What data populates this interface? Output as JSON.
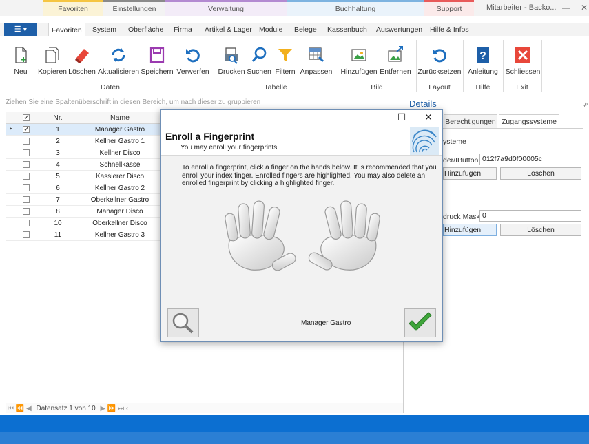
{
  "categories": [
    {
      "label": "Favoriten",
      "color": "#f5c542"
    },
    {
      "label": "Einstellungen",
      "color": "#8a8a8a"
    },
    {
      "label": "Verwaltung",
      "color": "#b38ad1"
    },
    {
      "label": "Buchhaltung",
      "color": "#7db3e0"
    },
    {
      "label": "Support",
      "color": "#e85a5a"
    }
  ],
  "window": {
    "title": "Mitarbeiter - Backo...",
    "minimize": "—",
    "restore": "▭",
    "close": "✕"
  },
  "app_menu": "☰ ▾",
  "tabs": [
    "Favoriten",
    "System",
    "Oberfläche",
    "Firma",
    "Artikel & Lager",
    "Module",
    "Belege",
    "Kassenbuch",
    "Auswertungen",
    "Hilfe & Infos"
  ],
  "ribbon": {
    "buttons": [
      "Neu",
      "Kopieren",
      "Löschen",
      "Aktualisieren",
      "Speichern",
      "Verwerfen",
      "Drucken",
      "Suchen",
      "Filtern",
      "Anpassen",
      "Hinzufügen",
      "Entfernen",
      "Zurücksetzen",
      "Anleitung",
      "Schliessen"
    ],
    "groups": [
      "Daten",
      "Tabelle",
      "Bild",
      "Layout",
      "Hilfe",
      "Exit"
    ]
  },
  "grid": {
    "group_hint": "Ziehen Sie eine Spaltenüberschrift in diesen Bereich, um nach dieser zu gruppieren",
    "columns": [
      "Nr.",
      "Name"
    ],
    "rows": [
      {
        "nr": "1",
        "name": "Manager Gastro",
        "checked": true
      },
      {
        "nr": "2",
        "name": "Kellner Gastro 1",
        "checked": false
      },
      {
        "nr": "3",
        "name": "Kellner Disco",
        "checked": false
      },
      {
        "nr": "4",
        "name": "Schnellkasse",
        "checked": false
      },
      {
        "nr": "5",
        "name": "Kassierer Disco",
        "checked": false
      },
      {
        "nr": "6",
        "name": "Kellner Gastro 2",
        "checked": false
      },
      {
        "nr": "7",
        "name": "Oberkellner Gastro",
        "checked": false
      },
      {
        "nr": "8",
        "name": "Manager Disco",
        "checked": false
      },
      {
        "nr": "10",
        "name": "Oberkellner Disco",
        "checked": false
      },
      {
        "nr": "11",
        "name": "Kellner Gastro 3",
        "checked": false
      }
    ],
    "navigator": "Datensatz 1 von 10"
  },
  "details": {
    "title": "Details",
    "tabs": [
      "Berechtigungen",
      "Zugangssysteme"
    ],
    "section": "ysteme",
    "reader_label": "der/IButton",
    "reader_value": "012f7a9d0f00005c",
    "add_label": "Hinzufügen",
    "delete_label": "Löschen",
    "mask_label": "druck Maske",
    "mask_value": "0"
  },
  "dialog": {
    "title": "Enroll a Fingerprint",
    "subtitle": "You may enroll your fingerprints",
    "instructions": "To enroll a fingerprint, click a finger on the hands below. It is recommended that you enroll your index finger. Enrolled fingers are highlighted. You may also delete an enrolled fingerprint by clicking a highlighted finger.",
    "user": "Manager Gastro",
    "minimize": "—",
    "maximize": "☐",
    "close": "✕"
  }
}
